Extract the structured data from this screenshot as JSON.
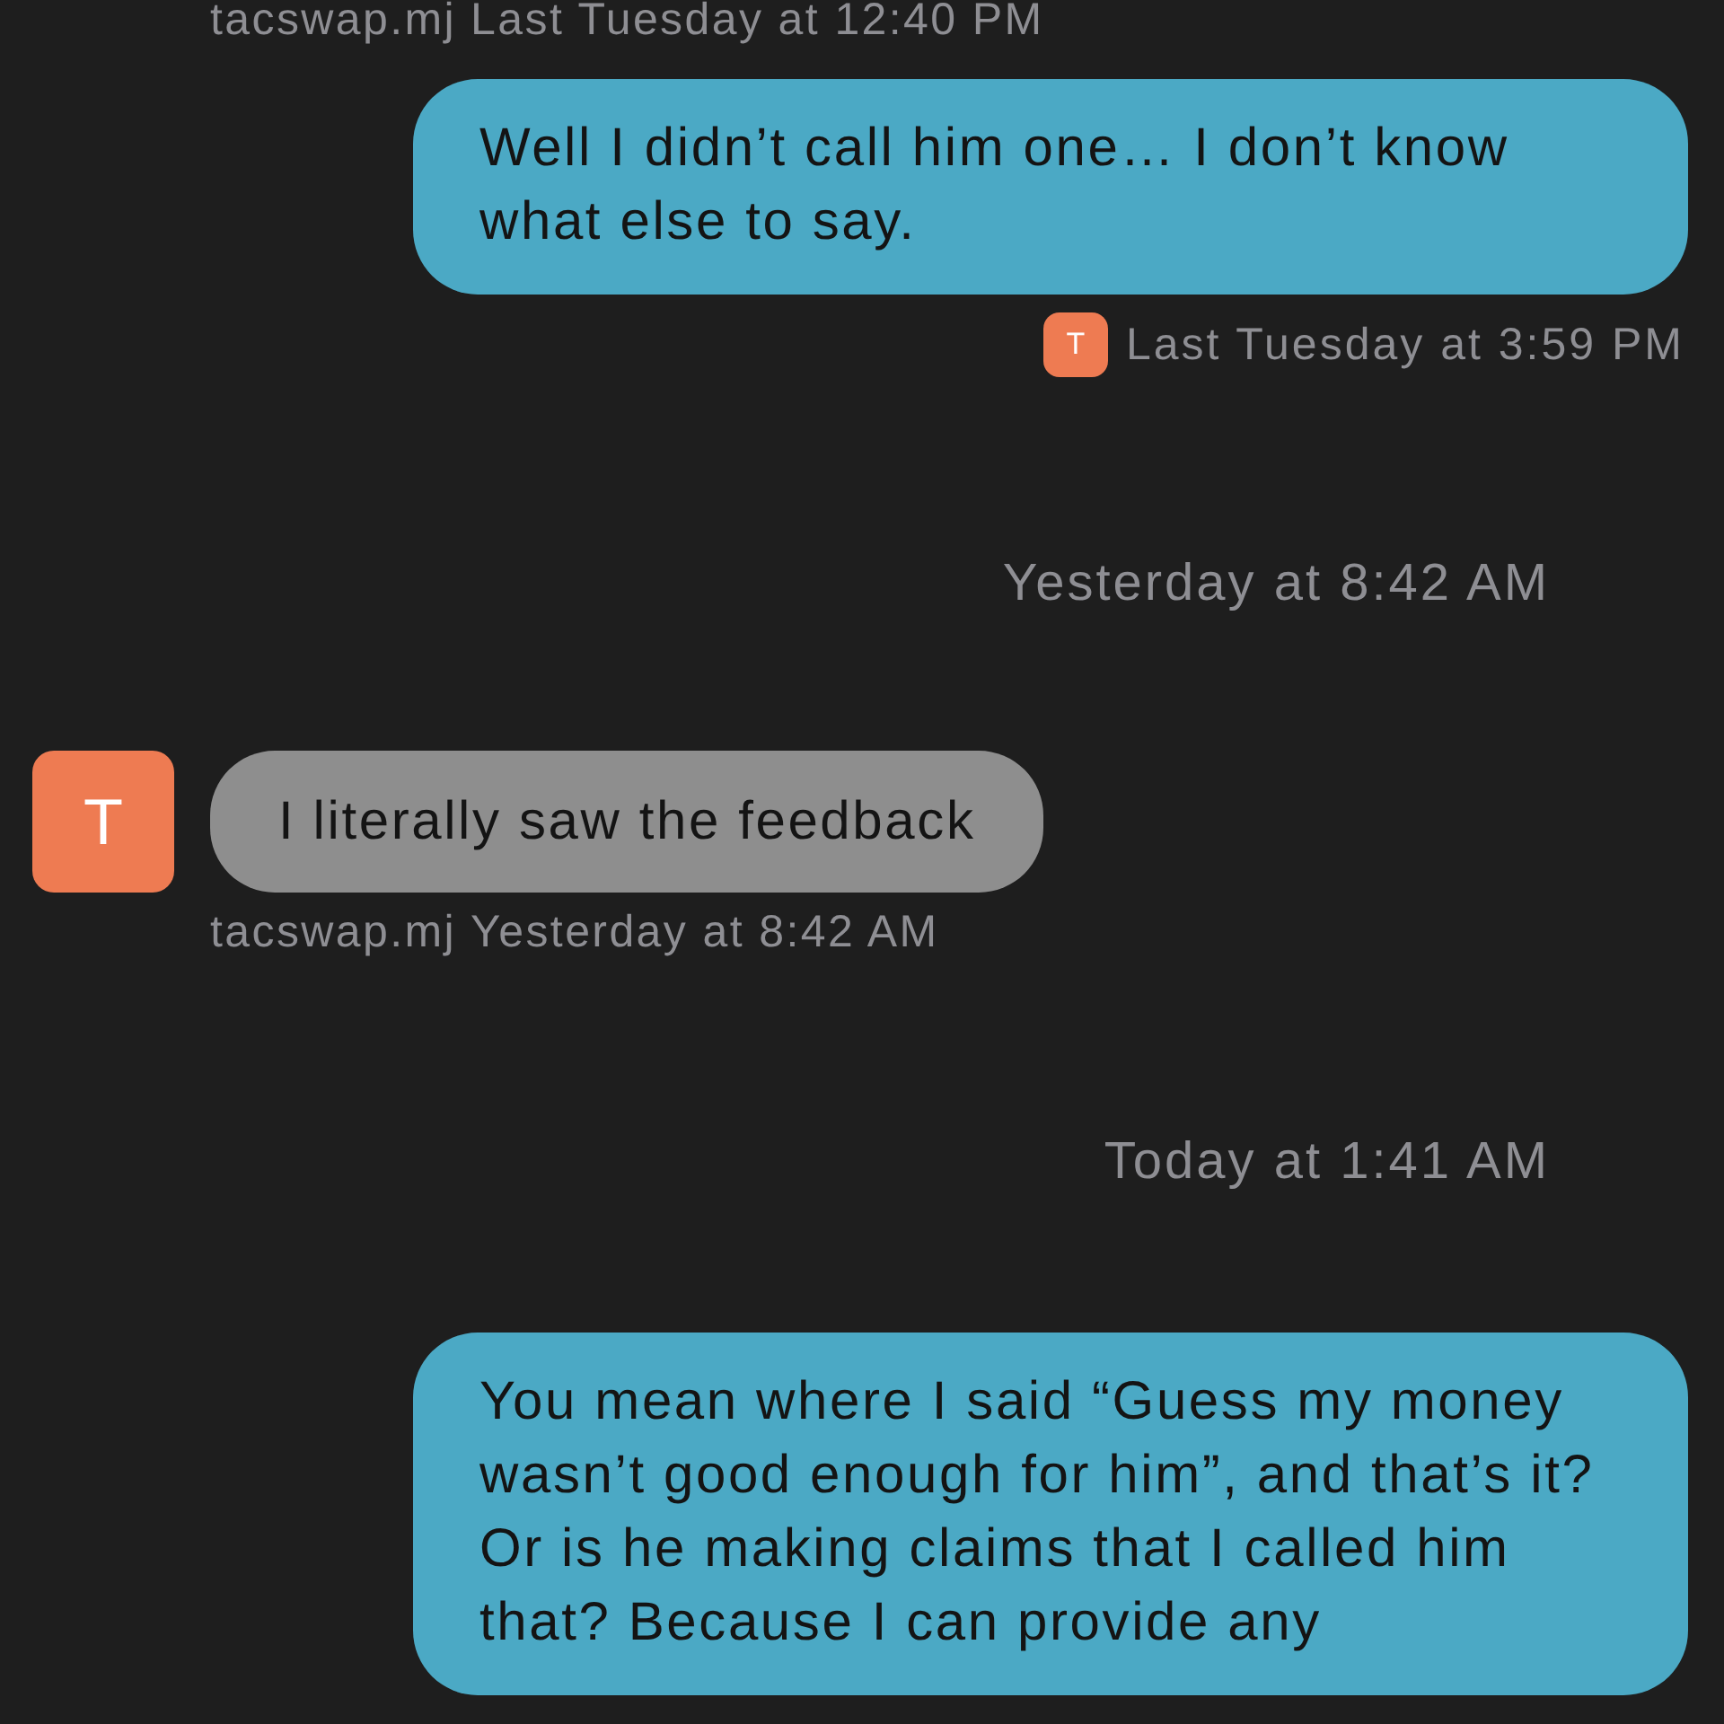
{
  "messages": [
    {
      "kind": "meta",
      "sender": "tacswap.mj",
      "time": "Last Tuesday at 12:40 PM"
    },
    {
      "kind": "outgoing",
      "text": "Well I didn’t call him one… I don’t know what else to say."
    },
    {
      "kind": "receipt",
      "avatar": "T",
      "time": "Last Tuesday at 3:59 PM"
    },
    {
      "kind": "date",
      "text": "Yesterday at 8:42 AM"
    },
    {
      "kind": "incoming",
      "avatar": "T",
      "text": "I literally saw the feedback"
    },
    {
      "kind": "meta",
      "sender": "tacswap.mj",
      "time": "Yesterday at 8:42 AM"
    },
    {
      "kind": "date",
      "text": "Today at 1:41 AM"
    },
    {
      "kind": "outgoing",
      "text": "You mean where I said “Guess my money wasn’t good enough for him”, and that’s it? Or is he making claims that I called him that? Because I can provide any"
    }
  ]
}
